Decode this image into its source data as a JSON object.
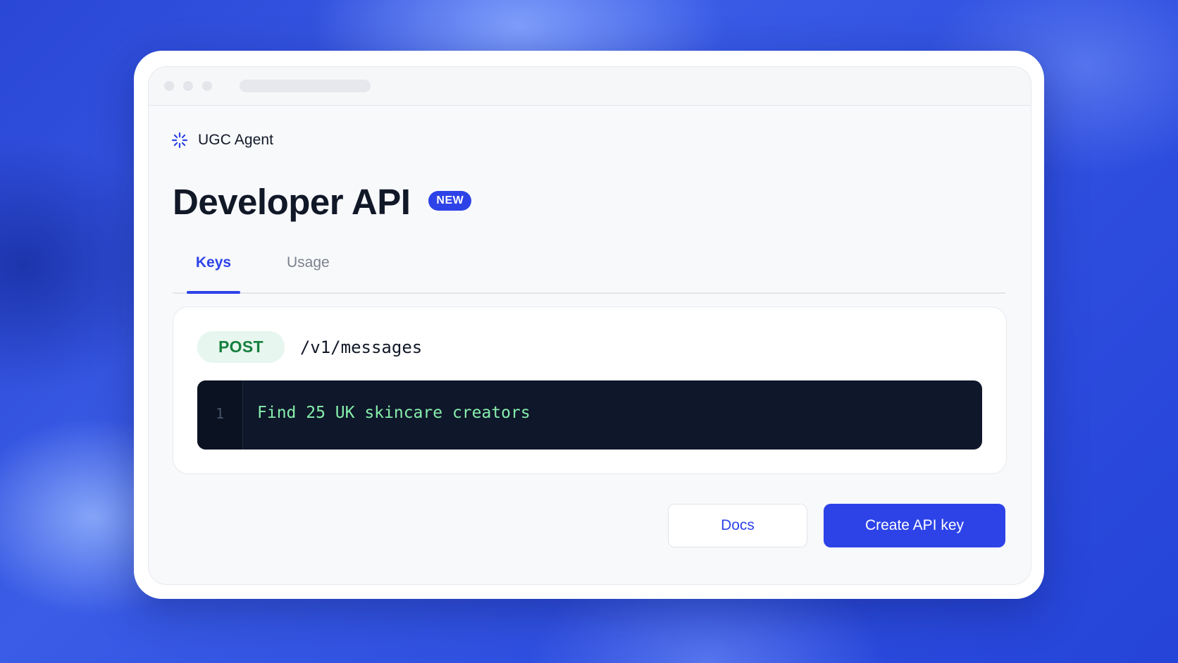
{
  "brand": {
    "name": "UGC Agent",
    "icon": "sparkle-burst-icon",
    "accent_color": "#2d43e8"
  },
  "page": {
    "title": "Developer API",
    "badge": "NEW"
  },
  "tabs": [
    {
      "label": "Keys",
      "active": true
    },
    {
      "label": "Usage",
      "active": false
    }
  ],
  "endpoint": {
    "method": "POST",
    "path": "/v1/messages",
    "method_color": "#15803d"
  },
  "code": {
    "lines": [
      {
        "number": "1",
        "text": "Find 25 UK skincare creators"
      }
    ]
  },
  "actions": {
    "docs_label": "Docs",
    "create_label": "Create API key"
  }
}
